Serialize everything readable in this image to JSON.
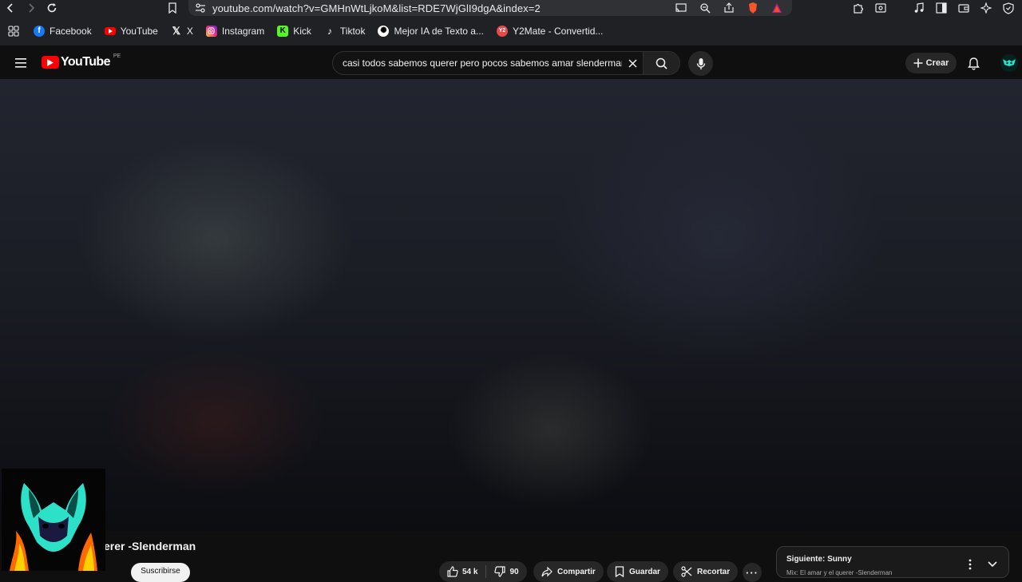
{
  "browser": {
    "url": "youtube.com/watch?v=GMHnWtLjkoM&list=RDE7WjGlI9dgA&index=2",
    "bookmarks": [
      {
        "label": "Facebook",
        "icon": "facebook-icon"
      },
      {
        "label": "YouTube",
        "icon": "youtube-icon"
      },
      {
        "label": "X",
        "icon": "x-icon"
      },
      {
        "label": "Instagram",
        "icon": "instagram-icon"
      },
      {
        "label": "Kick",
        "icon": "kick-icon"
      },
      {
        "label": "Tiktok",
        "icon": "tiktok-icon"
      },
      {
        "label": "Mejor IA de Texto a...",
        "icon": "chatgpt-icon"
      },
      {
        "label": "Y2Mate - Convertid...",
        "icon": "y2mate-icon"
      }
    ]
  },
  "youtube": {
    "logo_text": "YouTube",
    "country_code": "PE",
    "search_query": "casi todos sabemos querer pero pocos sabemos amar slenderman",
    "create_label": "Crear"
  },
  "video": {
    "title_visible": "erer -Slenderman",
    "subscribe_label": "Suscribirse",
    "likes": "54 k",
    "dislikes": "90",
    "share_label": "Compartir",
    "save_label": "Guardar",
    "clip_label": "Recortar",
    "more_label": "···"
  },
  "playlist": {
    "next_label": "Siguiente: Sunny",
    "mix_label": "Mix: El amar y el querer -Slenderman"
  },
  "colors": {
    "brand_red": "#ff0000",
    "background": "#0f0f0f",
    "avatar_accent": "#2de0c8"
  }
}
